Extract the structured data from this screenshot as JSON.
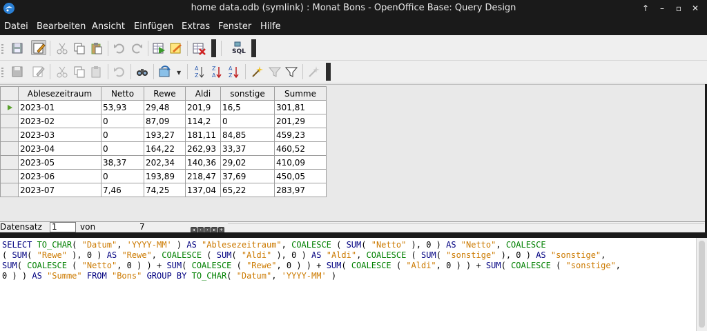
{
  "window": {
    "title": "home data.odb (symlink) : Monat Bons - OpenOffice Base: Query Design",
    "controls": [
      "↑",
      "–",
      "▫",
      "✕"
    ]
  },
  "menu": [
    {
      "label": "Datei"
    },
    {
      "label": "Bearbeiten"
    },
    {
      "label": "Ansicht"
    },
    {
      "label": "Einfügen"
    },
    {
      "label": "Extras"
    },
    {
      "label": "Fenster"
    },
    {
      "label": "Hilfe"
    }
  ],
  "grid": {
    "columns": [
      "Ablesezeitraum",
      "Netto",
      "Rewe",
      "Aldi",
      "sonstige",
      "Summe"
    ],
    "rows": [
      [
        "2023-01",
        "53,93",
        "29,48",
        "201,9",
        "16,5",
        "301,81"
      ],
      [
        "2023-02",
        "0",
        "87,09",
        "114,2",
        "0",
        "201,29"
      ],
      [
        "2023-03",
        "0",
        "193,27",
        "181,11",
        "84,85",
        "459,23"
      ],
      [
        "2023-04",
        "0",
        "164,22",
        "262,93",
        "33,37",
        "460,52"
      ],
      [
        "2023-05",
        "38,37",
        "202,34",
        "140,36",
        "29,02",
        "410,09"
      ],
      [
        "2023-06",
        "0",
        "193,89",
        "218,47",
        "37,69",
        "450,05"
      ],
      [
        "2023-07",
        "7,46",
        "74,25",
        "137,04",
        "65,22",
        "283,97"
      ]
    ],
    "current_row": 0
  },
  "navigator": {
    "record_label": "Datensatz",
    "record_value": "1",
    "of_label": "von",
    "total": "7"
  },
  "sql_text": "SELECT TO_CHAR( \"Datum\", 'YYYY-MM' ) AS \"Ablesezeitraum\", COALESCE ( SUM( \"Netto\" ), 0 ) AS \"Netto\", COALESCE ( SUM( \"Rewe\" ), 0 ) AS \"Rewe\", COALESCE ( SUM( \"Aldi\" ), 0 ) AS \"Aldi\", COALESCE ( SUM( \"sonstige\" ), 0 ) AS \"sonstige\", SUM( COALESCE ( \"Netto\", 0 ) ) + SUM( COALESCE ( \"Rewe\", 0 ) ) + SUM( COALESCE ( \"Aldi\", 0 ) ) + SUM( COALESCE ( \"sonstige\", 0 ) ) AS \"Summe\" FROM \"Bons\" GROUP BY TO_CHAR( \"Datum\", 'YYYY-MM' )",
  "sql_lines": [
    [
      [
        "kw",
        "SELECT "
      ],
      [
        "fn",
        "TO_CHAR"
      ],
      [
        "txt",
        "( "
      ],
      [
        "str",
        "\"Datum\""
      ],
      [
        "txt",
        ", "
      ],
      [
        "str",
        "'YYYY-MM'"
      ],
      [
        "txt",
        " ) "
      ],
      [
        "kw",
        "AS "
      ],
      [
        "str",
        "\"Ablesezeitraum\""
      ],
      [
        "txt",
        ", "
      ],
      [
        "fn",
        "COALESCE"
      ],
      [
        "txt",
        " ( "
      ],
      [
        "kw",
        "SUM"
      ],
      [
        "txt",
        "( "
      ],
      [
        "str",
        "\"Netto\""
      ],
      [
        "txt",
        " ), 0 ) "
      ],
      [
        "kw",
        "AS "
      ],
      [
        "str",
        "\"Netto\""
      ],
      [
        "txt",
        ", "
      ],
      [
        "fn",
        "COALESCE"
      ]
    ],
    [
      [
        "txt",
        "( "
      ],
      [
        "kw",
        "SUM"
      ],
      [
        "txt",
        "( "
      ],
      [
        "str",
        "\"Rewe\""
      ],
      [
        "txt",
        " ), 0 ) "
      ],
      [
        "kw",
        "AS "
      ],
      [
        "str",
        "\"Rewe\""
      ],
      [
        "txt",
        ", "
      ],
      [
        "fn",
        "COALESCE"
      ],
      [
        "txt",
        " ( "
      ],
      [
        "kw",
        "SUM"
      ],
      [
        "txt",
        "( "
      ],
      [
        "str",
        "\"Aldi\""
      ],
      [
        "txt",
        " ), 0 ) "
      ],
      [
        "kw",
        "AS "
      ],
      [
        "str",
        "\"Aldi\""
      ],
      [
        "txt",
        ", "
      ],
      [
        "fn",
        "COALESCE"
      ],
      [
        "txt",
        " ( "
      ],
      [
        "kw",
        "SUM"
      ],
      [
        "txt",
        "( "
      ],
      [
        "str",
        "\"sonstige\""
      ],
      [
        "txt",
        " ), 0 ) "
      ],
      [
        "kw",
        "AS "
      ],
      [
        "str",
        "\"sonstige\""
      ],
      [
        "txt",
        ","
      ]
    ],
    [
      [
        "kw",
        "SUM"
      ],
      [
        "txt",
        "( "
      ],
      [
        "fn",
        "COALESCE"
      ],
      [
        "txt",
        " ( "
      ],
      [
        "str",
        "\"Netto\""
      ],
      [
        "txt",
        ", 0 ) ) + "
      ],
      [
        "kw",
        "SUM"
      ],
      [
        "txt",
        "( "
      ],
      [
        "fn",
        "COALESCE"
      ],
      [
        "txt",
        " ( "
      ],
      [
        "str",
        "\"Rewe\""
      ],
      [
        "txt",
        ", 0 ) ) + "
      ],
      [
        "kw",
        "SUM"
      ],
      [
        "txt",
        "( "
      ],
      [
        "fn",
        "COALESCE"
      ],
      [
        "txt",
        " ( "
      ],
      [
        "str",
        "\"Aldi\""
      ],
      [
        "txt",
        ", 0 ) ) + "
      ],
      [
        "kw",
        "SUM"
      ],
      [
        "txt",
        "( "
      ],
      [
        "fn",
        "COALESCE"
      ],
      [
        "txt",
        " ( "
      ],
      [
        "str",
        "\"sonstige\""
      ],
      [
        "txt",
        ","
      ]
    ],
    [
      [
        "txt",
        "0 ) ) "
      ],
      [
        "kw",
        "AS "
      ],
      [
        "str",
        "\"Summe\""
      ],
      [
        "txt",
        " "
      ],
      [
        "kw",
        "FROM "
      ],
      [
        "str",
        "\"Bons\""
      ],
      [
        "txt",
        " "
      ],
      [
        "kw",
        "GROUP BY "
      ],
      [
        "fn",
        "TO_CHAR"
      ],
      [
        "txt",
        "( "
      ],
      [
        "str",
        "\"Datum\""
      ],
      [
        "txt",
        ", "
      ],
      [
        "str",
        "'YYYY-MM'"
      ],
      [
        "txt",
        " )"
      ]
    ]
  ],
  "icons": {
    "toolbar1": [
      "save-icon",
      "edit-mode-icon",
      "cut-icon",
      "copy-icon",
      "paste-icon",
      "undo-icon",
      "redo-icon",
      "run-query-icon",
      "design-view-icon",
      "clear-query-icon",
      "sql-icon"
    ],
    "toolbar2": [
      "save-record-icon",
      "edit-data-icon",
      "cut-icon",
      "copy-icon",
      "paste-icon",
      "undo-record-icon",
      "find-record-icon",
      "refresh-icon",
      "sort-ascending-icon",
      "sort-descending-icon",
      "sort-icon",
      "autofilter-icon",
      "standard-filter-icon",
      "apply-filter-icon",
      "remove-filter-icon"
    ]
  },
  "colors": {
    "titlebar": "#1a1a1a",
    "sql_keyword": "#000080",
    "sql_string": "#cc7a00",
    "sql_function": "#008000",
    "current_row_marker": "#5aa02c"
  }
}
